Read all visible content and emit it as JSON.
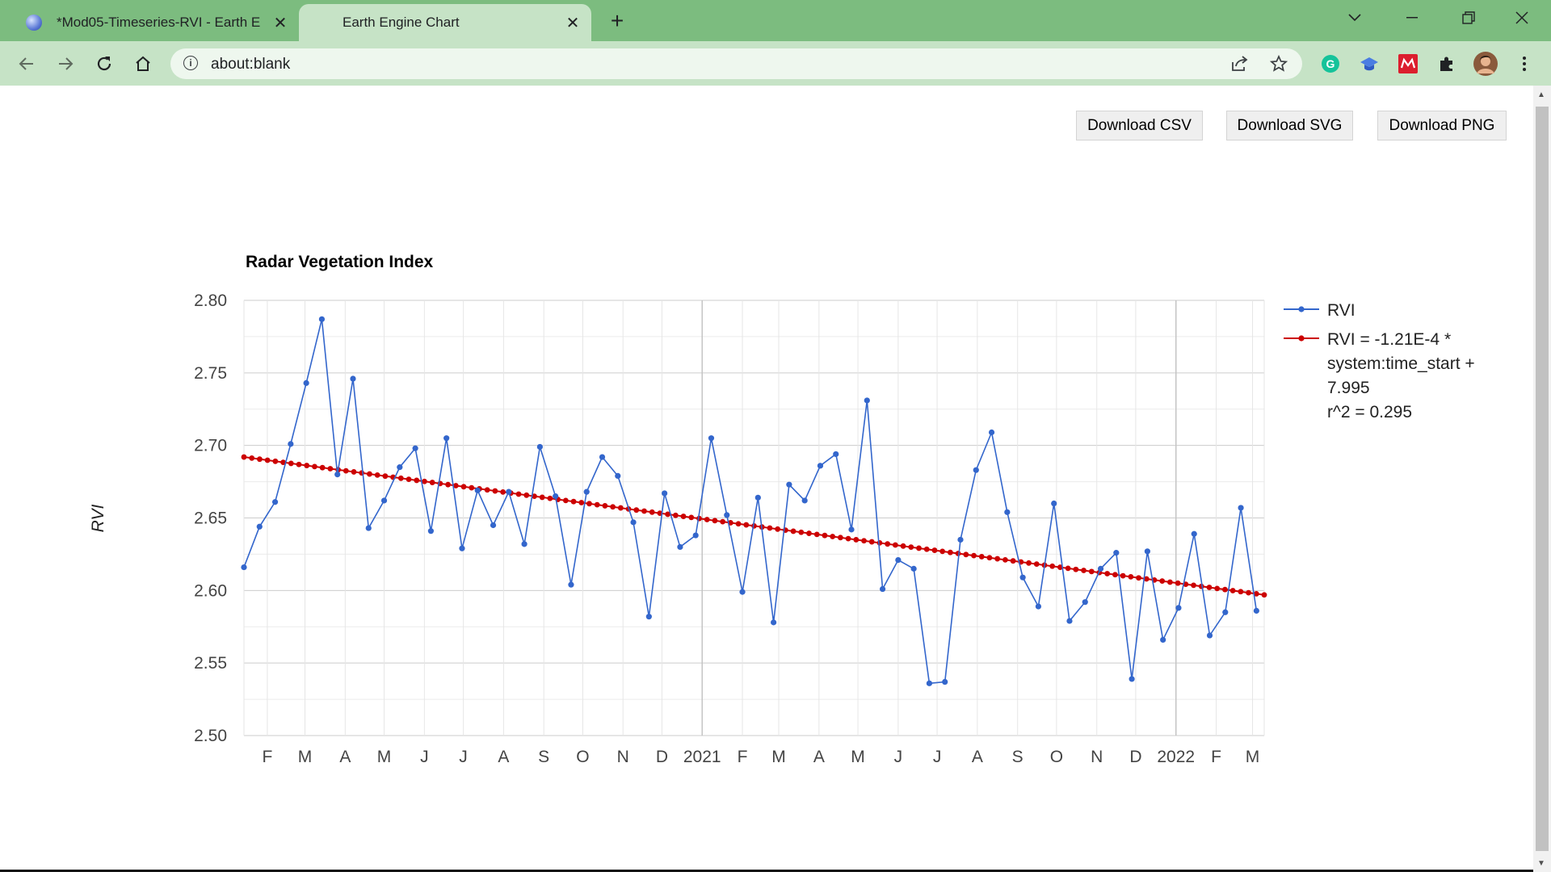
{
  "browser": {
    "tabs": [
      {
        "title": "*Mod05-Timeseries-RVI - Earth E",
        "active": false
      },
      {
        "title": "Earth Engine Chart",
        "active": true
      }
    ],
    "address": "about:blank",
    "colors": {
      "frame": "#7cbc7f",
      "toolbar": "#c6e3c6"
    }
  },
  "page": {
    "buttons": {
      "csv": "Download CSV",
      "svg": "Download SVG",
      "png": "Download PNG"
    }
  },
  "chart_data": {
    "type": "line",
    "title": "Radar Vegetation Index",
    "ylabel": "RVI",
    "xlabel": "",
    "ylim": [
      2.5,
      2.8
    ],
    "yticks": [
      "2.80",
      "2.75",
      "2.70",
      "2.65",
      "2.60",
      "2.55",
      "2.50"
    ],
    "x_range": [
      "2020-01-14",
      "2022-03-10"
    ],
    "xticks": [
      {
        "label": "F",
        "date": "2020-02-01"
      },
      {
        "label": "M",
        "date": "2020-03-01"
      },
      {
        "label": "A",
        "date": "2020-04-01"
      },
      {
        "label": "M",
        "date": "2020-05-01"
      },
      {
        "label": "J",
        "date": "2020-06-01"
      },
      {
        "label": "J",
        "date": "2020-07-01"
      },
      {
        "label": "A",
        "date": "2020-08-01"
      },
      {
        "label": "S",
        "date": "2020-09-01"
      },
      {
        "label": "O",
        "date": "2020-10-01"
      },
      {
        "label": "N",
        "date": "2020-11-01"
      },
      {
        "label": "D",
        "date": "2020-12-01"
      },
      {
        "label": "2021",
        "date": "2021-01-01",
        "major": true
      },
      {
        "label": "F",
        "date": "2021-02-01"
      },
      {
        "label": "M",
        "date": "2021-03-01"
      },
      {
        "label": "A",
        "date": "2021-04-01"
      },
      {
        "label": "M",
        "date": "2021-05-01"
      },
      {
        "label": "J",
        "date": "2021-06-01"
      },
      {
        "label": "J",
        "date": "2021-07-01"
      },
      {
        "label": "A",
        "date": "2021-08-01"
      },
      {
        "label": "S",
        "date": "2021-09-01"
      },
      {
        "label": "O",
        "date": "2021-10-01"
      },
      {
        "label": "N",
        "date": "2021-11-01"
      },
      {
        "label": "D",
        "date": "2021-12-01"
      },
      {
        "label": "2022",
        "date": "2022-01-01",
        "major": true
      },
      {
        "label": "F",
        "date": "2022-02-01"
      },
      {
        "label": "M",
        "date": "2022-03-01"
      }
    ],
    "grid": true,
    "legend_position": "right",
    "series": [
      {
        "name": "RVI",
        "color": "#3366cc",
        "points": [
          [
            "2020-01-14",
            2.616
          ],
          [
            "2020-01-26",
            2.644
          ],
          [
            "2020-02-07",
            2.661
          ],
          [
            "2020-02-19",
            2.701
          ],
          [
            "2020-03-02",
            2.743
          ],
          [
            "2020-03-14",
            2.787
          ],
          [
            "2020-03-26",
            2.68
          ],
          [
            "2020-04-07",
            2.746
          ],
          [
            "2020-04-19",
            2.643
          ],
          [
            "2020-05-01",
            2.662
          ],
          [
            "2020-05-13",
            2.685
          ],
          [
            "2020-05-25",
            2.698
          ],
          [
            "2020-06-06",
            2.641
          ],
          [
            "2020-06-18",
            2.705
          ],
          [
            "2020-06-30",
            2.629
          ],
          [
            "2020-07-12",
            2.669
          ],
          [
            "2020-07-24",
            2.645
          ],
          [
            "2020-08-05",
            2.668
          ],
          [
            "2020-08-17",
            2.632
          ],
          [
            "2020-08-29",
            2.699
          ],
          [
            "2020-09-10",
            2.665
          ],
          [
            "2020-09-22",
            2.604
          ],
          [
            "2020-10-04",
            2.668
          ],
          [
            "2020-10-16",
            2.692
          ],
          [
            "2020-10-28",
            2.679
          ],
          [
            "2020-11-09",
            2.647
          ],
          [
            "2020-11-21",
            2.582
          ],
          [
            "2020-12-03",
            2.667
          ],
          [
            "2020-12-15",
            2.63
          ],
          [
            "2020-12-27",
            2.638
          ],
          [
            "2021-01-08",
            2.705
          ],
          [
            "2021-01-20",
            2.652
          ],
          [
            "2021-02-01",
            2.599
          ],
          [
            "2021-02-13",
            2.664
          ],
          [
            "2021-02-25",
            2.578
          ],
          [
            "2021-03-09",
            2.673
          ],
          [
            "2021-03-21",
            2.662
          ],
          [
            "2021-04-02",
            2.686
          ],
          [
            "2021-04-14",
            2.694
          ],
          [
            "2021-04-26",
            2.642
          ],
          [
            "2021-05-08",
            2.731
          ],
          [
            "2021-05-20",
            2.601
          ],
          [
            "2021-06-01",
            2.621
          ],
          [
            "2021-06-13",
            2.615
          ],
          [
            "2021-06-25",
            2.536
          ],
          [
            "2021-07-07",
            2.537
          ],
          [
            "2021-07-19",
            2.635
          ],
          [
            "2021-07-31",
            2.683
          ],
          [
            "2021-08-12",
            2.709
          ],
          [
            "2021-08-24",
            2.654
          ],
          [
            "2021-09-05",
            2.609
          ],
          [
            "2021-09-17",
            2.589
          ],
          [
            "2021-09-29",
            2.66
          ],
          [
            "2021-10-11",
            2.579
          ],
          [
            "2021-10-23",
            2.592
          ],
          [
            "2021-11-04",
            2.615
          ],
          [
            "2021-11-16",
            2.626
          ],
          [
            "2021-11-28",
            2.539
          ],
          [
            "2021-12-10",
            2.627
          ],
          [
            "2021-12-22",
            2.566
          ],
          [
            "2022-01-03",
            2.588
          ],
          [
            "2022-01-15",
            2.639
          ],
          [
            "2022-01-27",
            2.569
          ],
          [
            "2022-02-08",
            2.585
          ],
          [
            "2022-02-20",
            2.657
          ],
          [
            "2022-03-04",
            2.586
          ]
        ]
      },
      {
        "name": "RVI = -1.21E-4 * system:time_start + 7.995",
        "legend_lines": [
          "RVI = -1.21E-4 *",
          "system:time_start +",
          "7.995",
          "r^2 = 0.295"
        ],
        "color": "#cc0000",
        "trendline": {
          "from": [
            "2020-01-14",
            2.692
          ],
          "to": [
            "2022-03-10",
            2.597
          ]
        }
      }
    ]
  }
}
